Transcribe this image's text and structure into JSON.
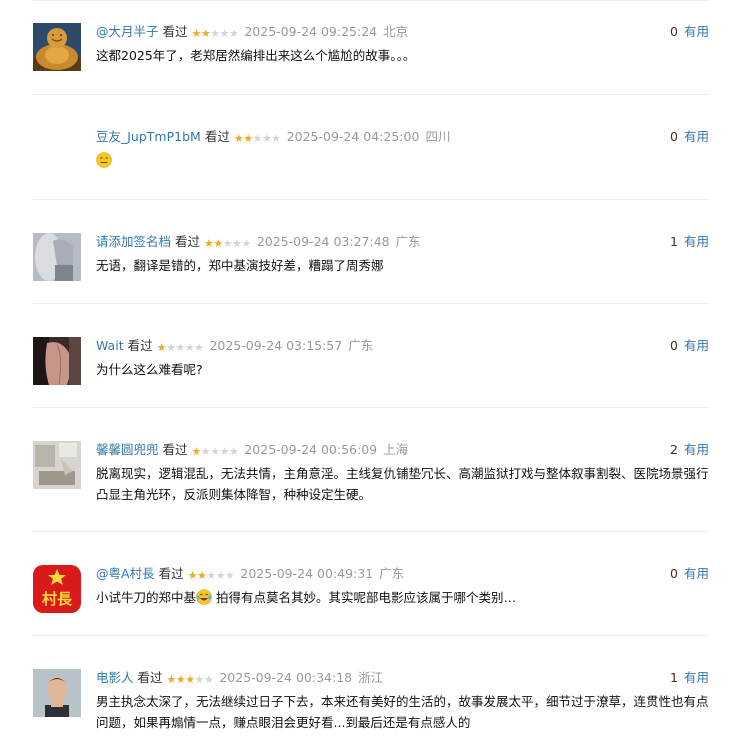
{
  "useful_label": "有用",
  "watched_label": "看过",
  "colors": {
    "link": "#3377aa",
    "star": "#f5a623",
    "meta": "#999999"
  },
  "comments": [
    {
      "user": "@大月半子",
      "stars": 2,
      "time": "2025-09-24 09:25:24",
      "location": "北京",
      "useful": "0",
      "text": "这都2025年了，老郑居然编排出来这么个尴尬的故事。。。",
      "avatar": "buddha-statue"
    },
    {
      "user": "豆友_JupTmP1bM",
      "stars": 2,
      "time": "2025-09-24 04:25:00",
      "location": "四川",
      "useful": "0",
      "text": "",
      "emoji": "expressionless-face-emoji",
      "avatar": "none"
    },
    {
      "user": "请添加签名档",
      "stars": 2,
      "time": "2025-09-24 03:27:48",
      "location": "广东",
      "useful": "1",
      "text": "无语，翻译是错的，郑中基演技好差，糟蹋了周秀娜",
      "avatar": "portrait-woman"
    },
    {
      "user": "Wait",
      "stars": 1,
      "time": "2025-09-24 03:15:57",
      "location": "广东",
      "useful": "0",
      "text": "为什么这么难看呢?",
      "avatar": "back-portrait"
    },
    {
      "user": "馨馨圆兜兜",
      "stars": 1,
      "time": "2025-09-24 00:56:09",
      "location": "上海",
      "useful": "2",
      "text": "脱离现实，逻辑混乱，无法共情，主角意淫。主线复仇铺垫冗长、高潮监狱打戏与整体叙事割裂、医院场景强行凸显主角光环，反派则集体降智，种种设定生硬。",
      "avatar": "room-photo"
    },
    {
      "user": "@粤A村長",
      "stars": 2,
      "time": "2025-09-24 00:49:31",
      "location": "广东",
      "useful": "0",
      "text_before": "小试牛刀的郑中基",
      "text_after": " 拍得有点莫名其妙。其实呢部电影应该属于哪个类别…",
      "avatar": "village-chief-logo",
      "avatar_text": "村長"
    },
    {
      "user": "电影人",
      "stars": 3,
      "time": "2025-09-24 00:34:18",
      "location": "浙江",
      "useful": "1",
      "text": "男主执念太深了，无法继续过日子下去，本来还有美好的生活的，故事发展太平，细节过于潦草，连贯性也有点问题，如果再煽情一点，赚点眼泪会更好看...到最后还是有点感人的",
      "avatar": "man-portrait"
    }
  ]
}
